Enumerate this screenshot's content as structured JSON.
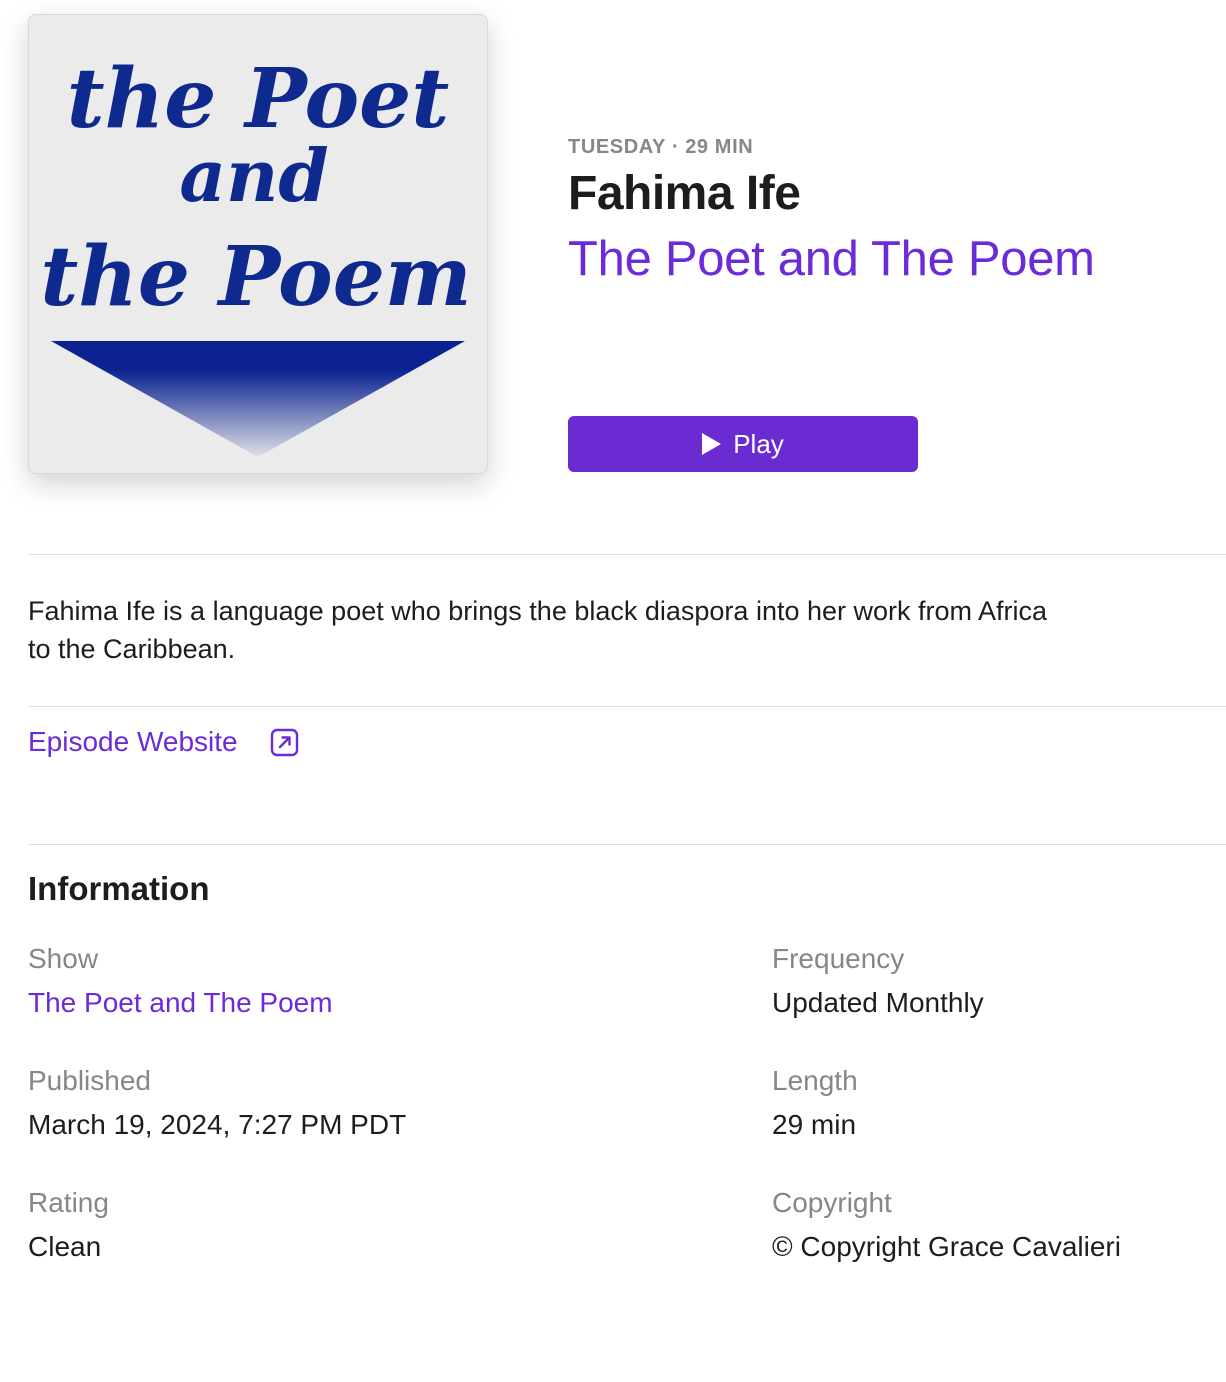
{
  "artwork": {
    "line1": "the Poet",
    "line2": "and",
    "line3": "the Poem",
    "text_color": "#0e2a8f",
    "triangle_color": "#0b2290"
  },
  "episode": {
    "day": "TUESDAY",
    "separator": "·",
    "duration": "29 MIN",
    "title": "Fahima Ife",
    "show_name": "The Poet and The Poem",
    "play_label": "Play",
    "description": "Fahima Ife is a language poet who brings the black diaspora into her work from Africa to the Caribbean.",
    "website_label": "Episode Website"
  },
  "information": {
    "heading": "Information",
    "show_label": "Show",
    "show_value": "The Poet and The Poem",
    "frequency_label": "Frequency",
    "frequency_value": "Updated Monthly",
    "published_label": "Published",
    "published_value": "March 19, 2024, 7:27 PM PDT",
    "length_label": "Length",
    "length_value": "29 min",
    "rating_label": "Rating",
    "rating_value": "Clean",
    "copyright_label": "Copyright",
    "copyright_value": "© Copyright Grace Cavalieri"
  },
  "colors": {
    "accent": "#6c2bd9",
    "play_button": "#6a2bd3",
    "muted_text": "#86868b",
    "primary_text": "#1d1d1f"
  },
  "icons": {
    "play": "play-icon",
    "external_link": "external-link-icon"
  }
}
